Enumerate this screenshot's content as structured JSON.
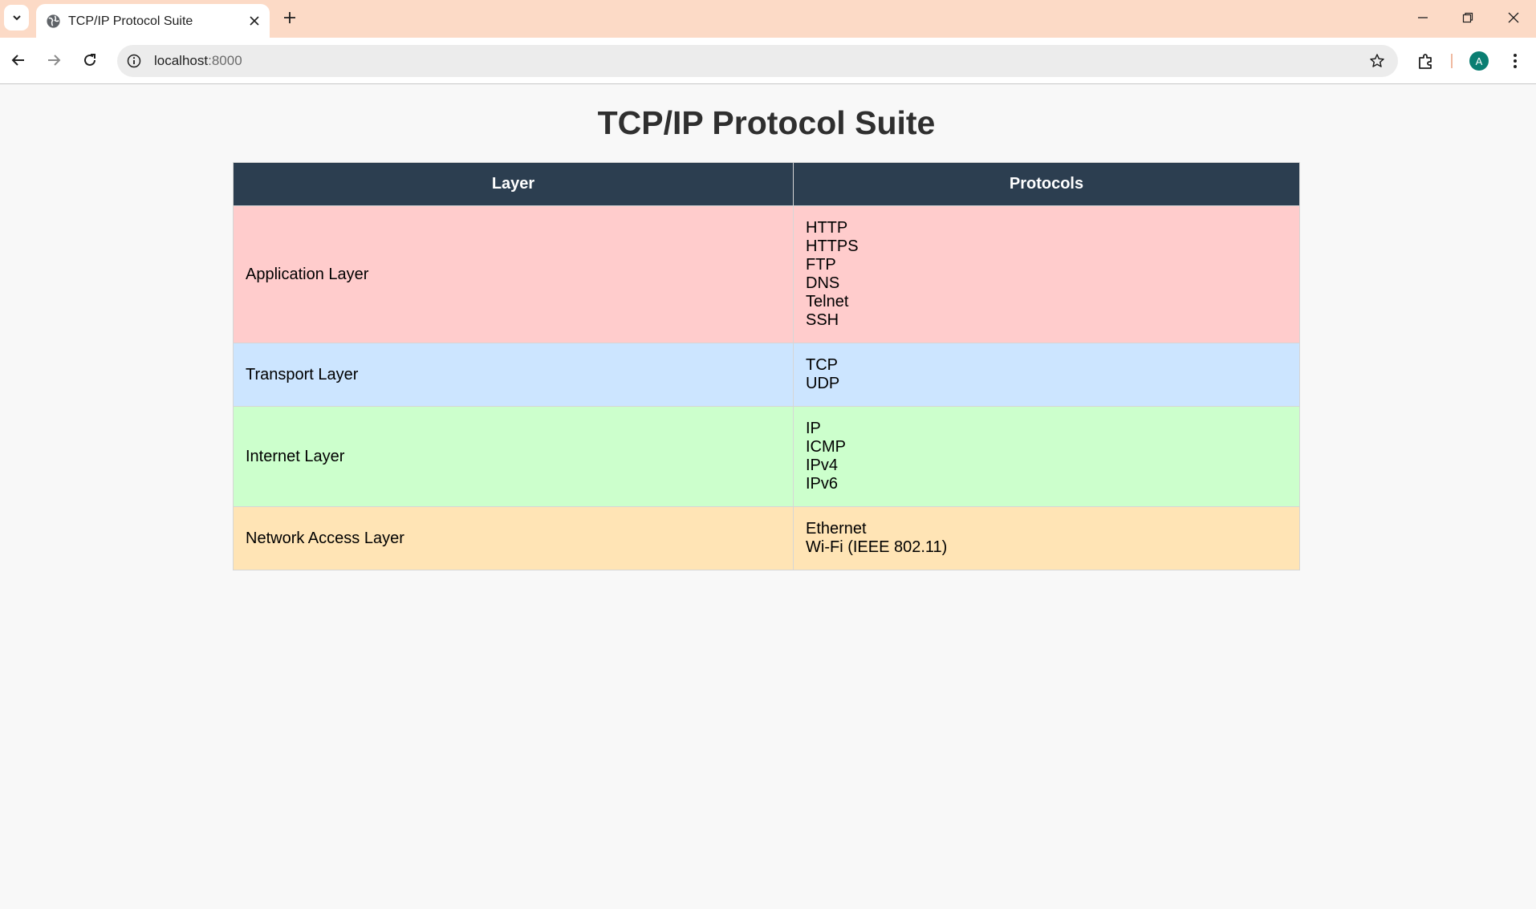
{
  "browser": {
    "tab_title": "TCP/IP Protocol Suite",
    "url_host": "localhost",
    "url_port": ":8000",
    "profile_initial": "A",
    "icons": [
      "tab-list-icon",
      "globe-icon",
      "close-icon",
      "plus-icon",
      "minimize-icon",
      "restore-icon",
      "window-close-icon",
      "back-arrow-icon",
      "forward-arrow-icon",
      "reload-icon",
      "info-icon",
      "star-icon",
      "puzzle-icon",
      "kebab-menu-icon"
    ],
    "colors": {
      "titlebar": "#fcdac6",
      "avatar": "#0a7e72"
    }
  },
  "page": {
    "title": "TCP/IP Protocol Suite",
    "table": {
      "headers": [
        "Layer",
        "Protocols"
      ],
      "rows": [
        {
          "layer": "Application Layer",
          "protocols": [
            "HTTP",
            "HTTPS",
            "FTP",
            "DNS",
            "Telnet",
            "SSH"
          ],
          "color": "#ffcccc"
        },
        {
          "layer": "Transport Layer",
          "protocols": [
            "TCP",
            "UDP"
          ],
          "color": "#cce5ff"
        },
        {
          "layer": "Internet Layer",
          "protocols": [
            "IP",
            "ICMP",
            "IPv4",
            "IPv6"
          ],
          "color": "#ccffcc"
        },
        {
          "layer": "Network Access Layer",
          "protocols": [
            "Ethernet",
            "Wi-Fi (IEEE 802.11)"
          ],
          "color": "#ffe4b5"
        }
      ],
      "header_color": "#2c3e50"
    }
  }
}
